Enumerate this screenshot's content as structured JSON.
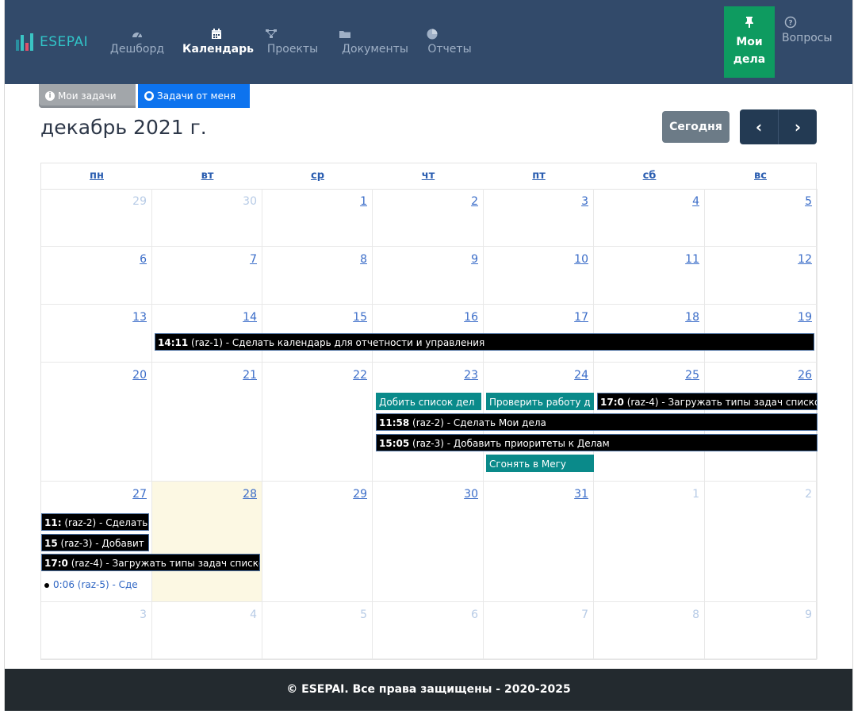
{
  "brand": {
    "name": "ESEPAI"
  },
  "nav": {
    "items": [
      {
        "label": "Дешборд",
        "icon": "dashboard-icon"
      },
      {
        "label": "Календарь",
        "icon": "calendar-icon"
      },
      {
        "label": "Проекты",
        "icon": "sitemap-icon"
      },
      {
        "label": "Документы",
        "icon": "folder-icon"
      },
      {
        "label": "Отчеты",
        "icon": "pie-chart-icon"
      }
    ],
    "active": "Календарь",
    "moi_dela": {
      "line1": "Мои",
      "line2": "дела",
      "icon": "pin-icon"
    },
    "voprosy": {
      "label": "Вопросы",
      "icon": "question-circle-icon"
    }
  },
  "toggles": {
    "my_tasks": "Мои задачи",
    "tasks_from_me": "Задачи от меня"
  },
  "calendar": {
    "title": "декабрь 2021 г.",
    "today_label": "Сегодня",
    "prev": "‹",
    "next": "›",
    "weekdays": [
      "пн",
      "вт",
      "ср",
      "чт",
      "пт",
      "сб",
      "вс"
    ],
    "weeks": [
      [
        "29",
        "30",
        "1",
        "2",
        "3",
        "4",
        "5"
      ],
      [
        "6",
        "7",
        "8",
        "9",
        "10",
        "11",
        "12"
      ],
      [
        "13",
        "14",
        "15",
        "16",
        "17",
        "18",
        "19"
      ],
      [
        "20",
        "21",
        "22",
        "23",
        "24",
        "25",
        "26"
      ],
      [
        "27",
        "28",
        "29",
        "30",
        "31",
        "1",
        "2"
      ],
      [
        "3",
        "4",
        "5",
        "6",
        "7",
        "8",
        "9"
      ]
    ],
    "other_month": [
      [
        true,
        true,
        false,
        false,
        false,
        false,
        false
      ],
      [
        false,
        false,
        false,
        false,
        false,
        false,
        false
      ],
      [
        false,
        false,
        false,
        false,
        false,
        false,
        false
      ],
      [
        false,
        false,
        false,
        false,
        false,
        false,
        false
      ],
      [
        false,
        false,
        false,
        false,
        false,
        true,
        true
      ],
      [
        true,
        true,
        true,
        true,
        true,
        true,
        true
      ]
    ],
    "today": "28",
    "events": {
      "e1": {
        "time": "14:11",
        "text": "(raz-1) - Сделать календарь для отчетности и управления"
      },
      "e2": {
        "text": "Добить список дел"
      },
      "e3": {
        "text": "Проверить работу д"
      },
      "e4": {
        "time": "17:0",
        "text": "(raz-4) - Загружать типы задач списко"
      },
      "e5": {
        "time": "11:58",
        "text": "(raz-2) - Сделать Мои дела"
      },
      "e6": {
        "time": "15:05",
        "text": "(raz-3) - Добавить приоритеты к Делам"
      },
      "e7": {
        "text": "Сгонять в Мегу"
      },
      "e8": {
        "time": "11:",
        "text": "(raz-2) - Сделать"
      },
      "e9": {
        "time": "15",
        "text": "(raz-3) - Добавит"
      },
      "e10": {
        "time": "17:0",
        "text": "(raz-4) - Загружать типы задач списко"
      },
      "e11": {
        "text": "0:06 (raz-5) - Сде"
      }
    }
  },
  "colors": {
    "nav_bg": "#324a6a",
    "moi_dela": "#0e9b60",
    "event_black": "#000000",
    "event_teal": "#0a8a8a",
    "today_bg": "#fcf8e3",
    "footer_bg": "#232a2f"
  },
  "footer": {
    "text": "© ESEPAI. Все права защищены - 2020-2025"
  }
}
